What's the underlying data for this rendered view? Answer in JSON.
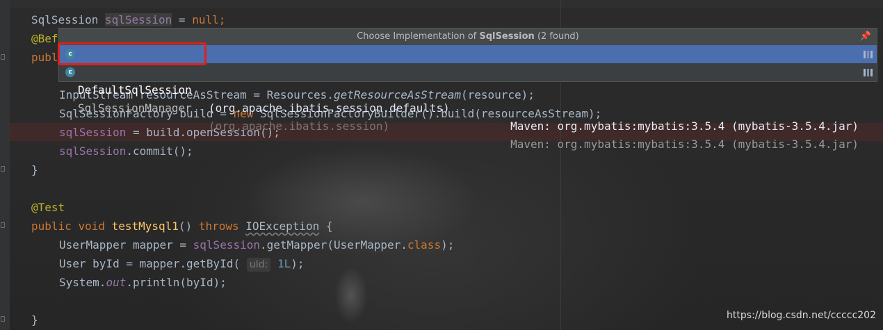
{
  "editor": {
    "lines": {
      "l1": {
        "type": "SqlSession",
        "var": "sqlSession",
        "eq": " = ",
        "val": "null",
        "semi": ";"
      },
      "l2": {
        "text": "@Bef"
      },
      "l3": {
        "text": "publ"
      },
      "l5": {
        "a": "InputStream resourceAsStream = Resources.",
        "b": "getResourceAsStream",
        "c": "(resource);"
      },
      "l6": {
        "a": "SqlSessionFactory build = ",
        "kw": "new",
        "b": " SqlSessionFactoryBuilder().build(resourceAsStream);"
      },
      "l7": {
        "var": "sqlSession",
        "a": " = build.openSession();"
      },
      "l8": {
        "var": "sqlSession",
        "a": ".commit();"
      },
      "l9": {
        "text": "}"
      },
      "l11": {
        "text": "@Test"
      },
      "l12": {
        "kw1": "public",
        "kw2": "void",
        "method": "testMysql1",
        "a": "() ",
        "kw3": "throws",
        "exc": "IOException",
        "b": " {"
      },
      "l13": {
        "a": "UserMapper mapper = ",
        "var": "sqlSession",
        "b": ".getMapper(UserMapper.",
        "kw": "class",
        "c": ");"
      },
      "l14": {
        "a": "User byId = mapper.getById(",
        "hint": "uId:",
        "num": "1L",
        "c": ");"
      },
      "l15": {
        "a": "System.",
        "out": "out",
        "b": ".println(byId);"
      },
      "l17": {
        "text": "}"
      }
    }
  },
  "popup": {
    "title_prefix": "Choose Implementation of ",
    "title_bold": "SqlSession",
    "title_suffix": " (2 found)",
    "items": [
      {
        "icon": "c",
        "name": "DefaultSqlSession",
        "pkg": "(org.apache.ibatis.session.defaults)",
        "source": "Maven: org.mybatis:mybatis:3.5.4 (mybatis-3.5.4.jar)"
      },
      {
        "icon": "c",
        "name": "SqlSessionManager",
        "pkg": "(org.apache.ibatis.session)",
        "source": "Maven: org.mybatis:mybatis:3.5.4 (mybatis-3.5.4.jar)"
      }
    ]
  },
  "watermark": "https://blog.csdn.net/ccccc202",
  "colors": {
    "selection": "#4b6eaf",
    "highlight_box": "#e0201b",
    "keyword": "#cc7832",
    "field": "#9876aa"
  }
}
